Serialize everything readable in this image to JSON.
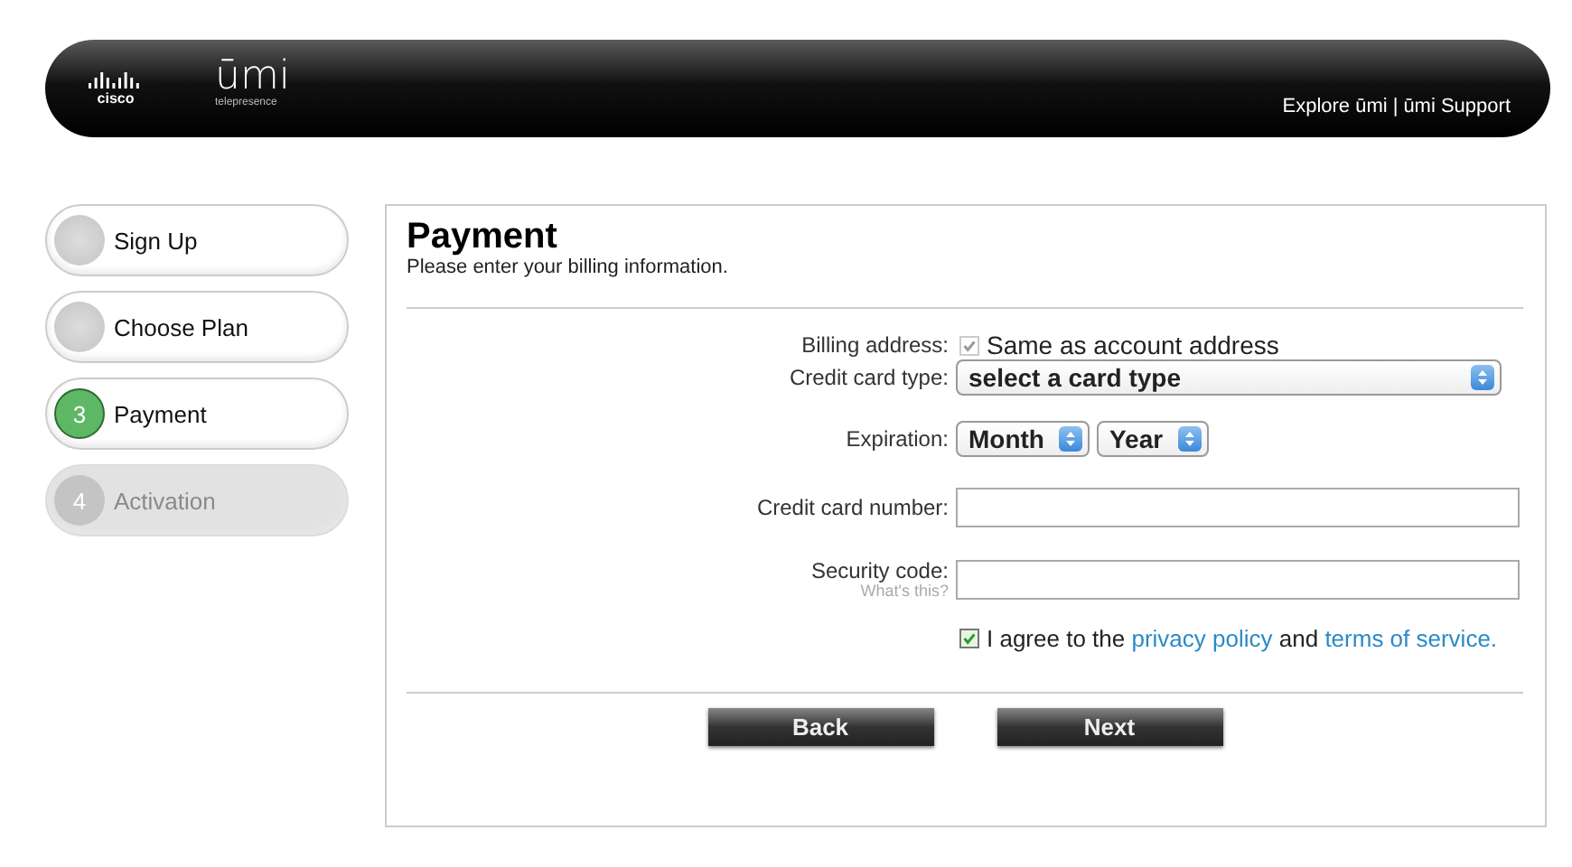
{
  "header": {
    "logo_brand": "cisco",
    "logo_product": "ūmi",
    "logo_tagline": "telepresence",
    "links": [
      {
        "label": "Explore ūmi"
      },
      {
        "label": "ūmi Support"
      }
    ],
    "separator": "|"
  },
  "steps": [
    {
      "label": "Sign Up",
      "completed": true,
      "selected": false,
      "disabled": false
    },
    {
      "label": "Choose Plan",
      "completed": true,
      "selected": false,
      "disabled": false
    },
    {
      "label": "Payment",
      "number": "3",
      "completed": false,
      "selected": true,
      "disabled": false
    },
    {
      "label": "Activation",
      "number": "4",
      "completed": false,
      "selected": false,
      "disabled": true
    }
  ],
  "form": {
    "title": "Payment",
    "subtitle": "Please enter your billing information.",
    "billing": {
      "label": "Billing address:",
      "option": "Same as account address",
      "checked": true,
      "disabled": true
    },
    "card_type": {
      "label": "Credit card type:",
      "value": "select a card type"
    },
    "expiration": {
      "label": "Expiration:",
      "month": "Month",
      "year": "Year"
    },
    "card_number": {
      "label": "Credit card number:"
    },
    "security_code": {
      "label": "Security code:",
      "help": "What's this?"
    },
    "agree": {
      "checked": true,
      "text_before": "I agree to the",
      "link_1": "privacy policy",
      "text_middle": "and",
      "link_2": "terms of service."
    },
    "buttons": [
      {
        "label": "Back"
      },
      {
        "label": "Next"
      }
    ]
  }
}
